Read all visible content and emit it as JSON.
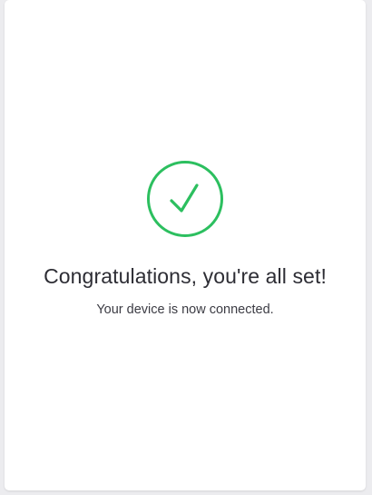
{
  "success": {
    "icon": "checkmark-circle-icon",
    "accent_color": "#2cbf5f",
    "title": "Congratulations, you're all set!",
    "message": "Your device is now connected."
  }
}
